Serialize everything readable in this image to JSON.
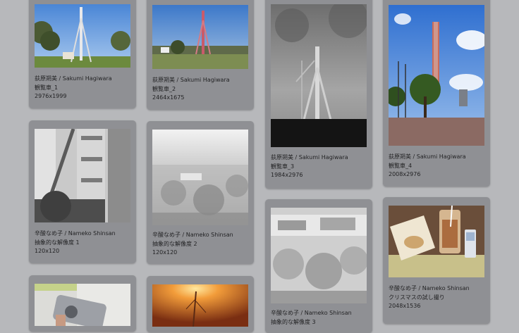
{
  "photos": [
    {
      "author": "荻原朔美 / Sakumi Hagiwara",
      "title": "観覧車_1",
      "size": "2976x1999",
      "thumb_icon": "ferris-wheel-photo"
    },
    {
      "author": "荻原朔美 / Sakumi Hagiwara",
      "title": "観覧車_2",
      "size": "2464x1675",
      "thumb_icon": "ferris-wheel-photo"
    },
    {
      "author": "荻原朔美 / Sakumi Hagiwara",
      "title": "観覧車_3",
      "size": "1984x2976",
      "thumb_icon": "ferris-wheel-construction-photo"
    },
    {
      "author": "荻原朔美 / Sakumi Hagiwara",
      "title": "観覧車_4",
      "size": "2008x2976",
      "thumb_icon": "ferris-wheel-tower-photo"
    },
    {
      "author": "辛酸なめ子 / Nameko Shinsan",
      "title": "抽象的な解像度 1",
      "size": "120x120",
      "thumb_icon": "grainy-building-photo"
    },
    {
      "author": "辛酸なめ子 / Nameko Shinsan",
      "title": "抽象的な解像度 2",
      "size": "120x120",
      "thumb_icon": "grainy-cityscape-photo"
    },
    {
      "author": "辛酸なめ子 / Nameko Shinsan",
      "title": "抽象的な解像度 3",
      "size": "",
      "thumb_icon": "grainy-cityscape-photo"
    },
    {
      "author": "辛酸なめ子 / Nameko Shinsan",
      "title": "クリスマスの試し撮り",
      "size": "2048x1536",
      "thumb_icon": "food-tray-photo"
    },
    {
      "author": "",
      "title": "",
      "size": "",
      "thumb_icon": "camera-photo"
    },
    {
      "author": "",
      "title": "",
      "size": "",
      "thumb_icon": "orange-light-photo"
    }
  ]
}
